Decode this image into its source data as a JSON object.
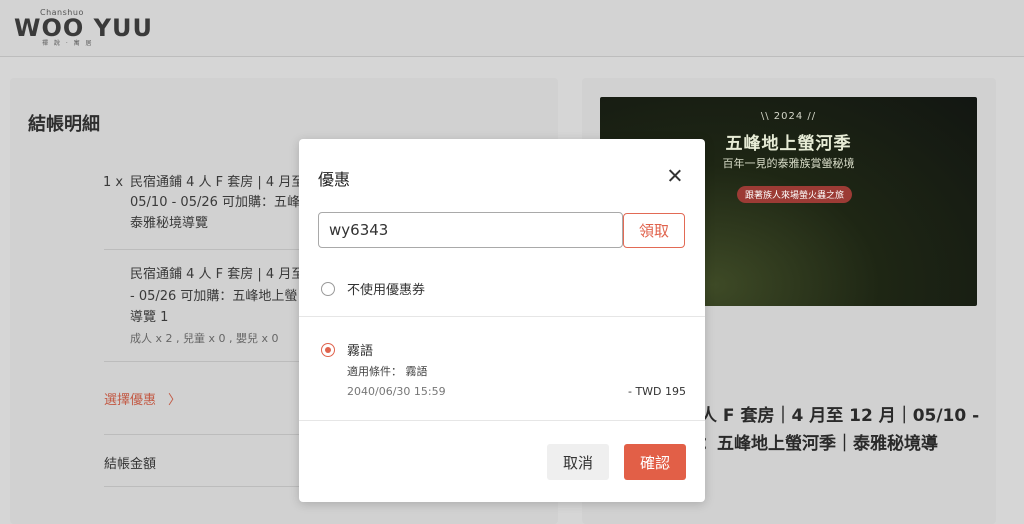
{
  "header": {
    "logo_small": "Chanshuo",
    "logo_main": "WOO YUU",
    "logo_dots": "禪 說 · 寓 居"
  },
  "checkout": {
    "title": "結帳明細",
    "item1": {
      "qty": "1 x",
      "line1": "民宿通鋪 4 人 F 套房 | 4 月至",
      "line2": "05/10 - 05/26 可加購：五峰",
      "line3": "泰雅秘境導覽"
    },
    "item2": {
      "line1": "民宿通鋪 4 人 F 套房 | 4 月至",
      "line2": "- 05/26 可加購：五峰地上螢",
      "line3": "導覽 1",
      "guests": "成人 x 2 , 兒童 x 0 , 嬰兒 x 0"
    },
    "coupon_link": "選擇優惠",
    "coupon_chevron": "〉",
    "total_label": "結帳金額"
  },
  "banner": {
    "year": "\\\\ 2024 //",
    "title": "五峰地上螢河季",
    "subtitle": "百年一見的泰雅族賞螢秘境",
    "pill": "跟著族人來場螢火蟲之旅"
  },
  "product": {
    "line1": "人 F 套房｜4 月至 12 月｜05/10 -",
    "line2": "：五峰地上螢河季｜泰雅秘境導"
  },
  "modal": {
    "title": "優惠",
    "coupon_code": "wy6343",
    "claim_label": "領取",
    "no_coupon_label": "不使用優惠券",
    "coupon": {
      "name": "霧語",
      "condition_label": "適用條件：",
      "condition_value": "霧語",
      "expiry": "2040/06/30 15:59",
      "amount": "- TWD 195",
      "selected": true
    },
    "cancel_label": "取消",
    "confirm_label": "確認"
  },
  "colors": {
    "accent": "#e25f47",
    "overlay_bg": "#d6d6d6"
  }
}
